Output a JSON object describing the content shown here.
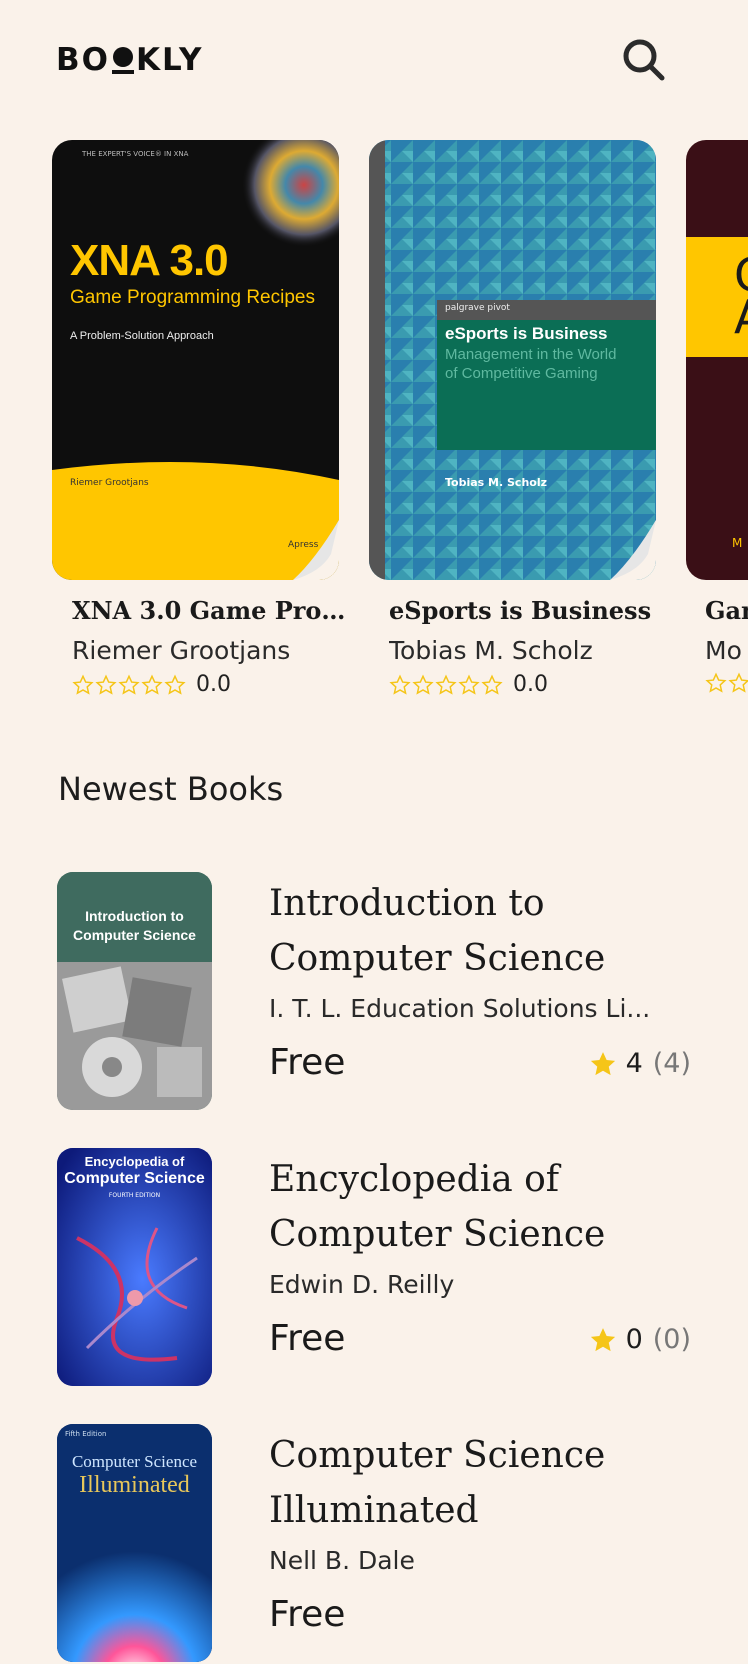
{
  "header": {
    "logo_part1": "B",
    "logo_part2": "O",
    "logo_part3": "KLY",
    "search_icon": "search-icon"
  },
  "featured": [
    {
      "title": "XNA 3.0 Game Programming Recipes",
      "display_title": "XNA 3.0 Game Progr...",
      "author": "Riemer Grootjans",
      "rating": "0.0",
      "cover": {
        "top_tag": "THE EXPERT'S VOICE® IN XNA",
        "big": "XNA 3.0",
        "sub": "Game Programming Recipes",
        "tagline": "A Problem-Solution Approach",
        "author": "Riemer Grootjans",
        "publisher": "Apress"
      }
    },
    {
      "title": "eSports is Business",
      "display_title": "eSports is Business",
      "author": "Tobias M. Scholz",
      "rating": "0.0",
      "cover": {
        "series": "palgrave pivot",
        "title": "eSports is Business",
        "subtitle_line1": "Management in the World",
        "subtitle_line2": "of Competitive Gaming",
        "author": "Tobias M. Scholz"
      }
    },
    {
      "title": "Gan",
      "display_title": "Gan",
      "author": "Mo",
      "rating": "",
      "cover": {
        "big": "G",
        "big2": "A",
        "bottom": "M C"
      }
    }
  ],
  "newest": {
    "title": "Newest Books",
    "books": [
      {
        "title": "Introduction to Computer Science",
        "author": "I. T. L. Education Solutions Li...",
        "price": "Free",
        "rating": "4",
        "rating_count": "(4)",
        "cover": {
          "line1": "Introduction to",
          "line2": "Computer Science"
        }
      },
      {
        "title": "Encyclopedia of Computer Science",
        "author": "Edwin D. Reilly",
        "price": "Free",
        "rating": "0",
        "rating_count": "(0)",
        "cover": {
          "line1": "Encyclopedia of",
          "line2": "Computer Science",
          "edition": "FOURTH EDITION"
        }
      },
      {
        "title": "Computer Science Illuminated",
        "author": "Nell B. Dale",
        "price": "Free",
        "rating": "",
        "rating_count": "",
        "cover": {
          "edition": "Fifth Edition",
          "line1": "Computer Science",
          "line2": "Illuminated"
        }
      }
    ]
  },
  "colors": {
    "background": "#faf2ea",
    "star": "#f5c518",
    "text": "#1d1d1d"
  }
}
